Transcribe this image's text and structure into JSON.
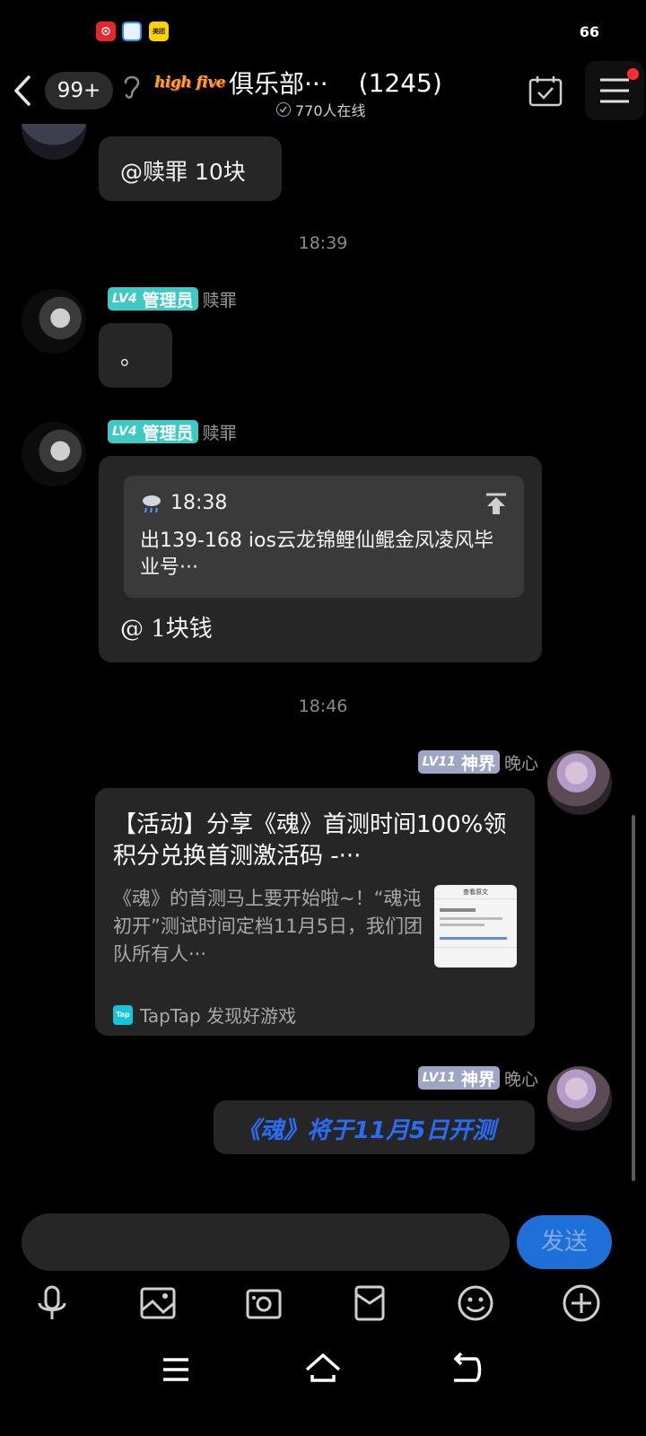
{
  "status_bar": {
    "battery": "66",
    "notification_icons": [
      "netease-music-icon",
      "browser-icon",
      "meituan-icon"
    ],
    "meituan_label": "美团"
  },
  "header": {
    "unread_count": "99+",
    "club_logo": "high five",
    "club_name": "俱乐部···",
    "member_count": "(1245)",
    "online_text": "770人在线"
  },
  "messages": {
    "m1": {
      "text": "@赎罪 10块"
    },
    "t1": "18:39",
    "m2": {
      "level": "LV4",
      "role": "管理员",
      "sender": "赎罪",
      "text": "。"
    },
    "m3": {
      "level": "LV4",
      "role": "管理员",
      "sender": "赎罪",
      "quote_time": "18:38",
      "quote_text": "出139-168 ios云龙锦鲤仙鲲金凤凌风毕业号···",
      "text": "@ 1块钱"
    },
    "t2": "18:46",
    "m4": {
      "level": "LV11",
      "role": "神界",
      "sender": "晚心",
      "title": "【活动】分享《魂》首测时间100%领积分兑换首测激活码 -···",
      "desc": "《魂》的首测马上要开始啦~！“魂沌初开”测试时间定档11月5日，我们团队所有人···",
      "thumb_title": "查看原文",
      "source": "TapTap 发现好游戏",
      "source_logo": "Tap"
    },
    "m5": {
      "level": "LV11",
      "role": "神界",
      "sender": "晚心",
      "text": "《魂》将于11月5日开测"
    }
  },
  "input": {
    "send_label": "发送",
    "placeholder": ""
  },
  "colors": {
    "admin_badge": "#3ec9c4",
    "god_badge": "#9ea6c5",
    "send_button": "#1f6fd9",
    "highlight_text": "#2a6cf5"
  }
}
